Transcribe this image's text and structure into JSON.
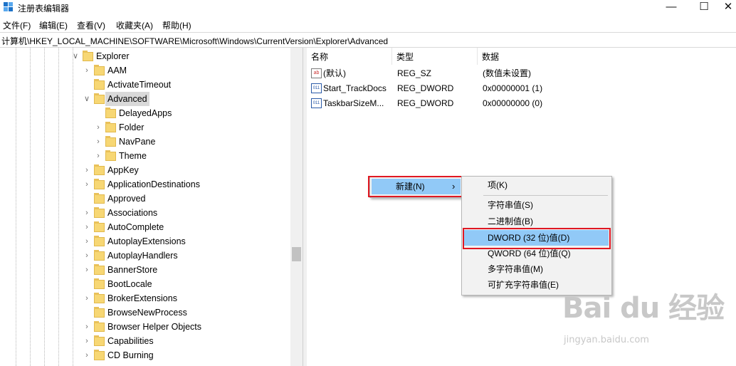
{
  "window": {
    "title": "注册表编辑器",
    "controls": {
      "minimize": "—",
      "maximize": "☐",
      "close": "✕"
    }
  },
  "menu": [
    "文件(F)",
    "编辑(E)",
    "查看(V)",
    "收藏夹(A)",
    "帮助(H)"
  ],
  "address": "计算机\\HKEY_LOCAL_MACHINE\\SOFTWARE\\Microsoft\\Windows\\CurrentVersion\\Explorer\\Advanced",
  "tree": {
    "items": [
      {
        "label": "Explorer",
        "chevron": "∨"
      },
      {
        "label": "AAM",
        "chevron": "›"
      },
      {
        "label": "ActivateTimeout",
        "chevron": ""
      },
      {
        "label": "Advanced",
        "chevron": "∨"
      },
      {
        "label": "DelayedApps",
        "chevron": ""
      },
      {
        "label": "Folder",
        "chevron": "›"
      },
      {
        "label": "NavPane",
        "chevron": "›"
      },
      {
        "label": "Theme",
        "chevron": "›"
      },
      {
        "label": "AppKey",
        "chevron": "›"
      },
      {
        "label": "ApplicationDestinations",
        "chevron": "›"
      },
      {
        "label": "Approved",
        "chevron": ""
      },
      {
        "label": "Associations",
        "chevron": "›"
      },
      {
        "label": "AutoComplete",
        "chevron": "›"
      },
      {
        "label": "AutoplayExtensions",
        "chevron": "›"
      },
      {
        "label": "AutoplayHandlers",
        "chevron": "›"
      },
      {
        "label": "BannerStore",
        "chevron": "›"
      },
      {
        "label": "BootLocale",
        "chevron": ""
      },
      {
        "label": "BrokerExtensions",
        "chevron": "›"
      },
      {
        "label": "BrowseNewProcess",
        "chevron": ""
      },
      {
        "label": "Browser Helper Objects",
        "chevron": "›"
      },
      {
        "label": "Capabilities",
        "chevron": "›"
      },
      {
        "label": "CD Burning",
        "chevron": "›"
      }
    ]
  },
  "list": {
    "headers": {
      "name": "名称",
      "type": "类型",
      "data": "数据"
    },
    "rows": [
      {
        "icon": "ab",
        "name": "(默认)",
        "type": "REG_SZ",
        "data": "(数值未设置)"
      },
      {
        "icon": "011",
        "name": "Start_TrackDocs",
        "type": "REG_DWORD",
        "data": "0x00000001 (1)"
      },
      {
        "icon": "011",
        "name": "TaskbarSizeM...",
        "type": "REG_DWORD",
        "data": "0x00000000 (0)"
      }
    ]
  },
  "context_menu": {
    "parent": {
      "label": "新建(N)",
      "arrow": "›"
    },
    "submenu": {
      "key": "项(K)",
      "items": [
        "字符串值(S)",
        "二进制值(B)",
        "DWORD (32 位)值(D)",
        "QWORD (64 位)值(Q)",
        "多字符串值(M)",
        "可扩充字符串值(E)"
      ]
    }
  },
  "watermark": {
    "brand": "Bai du 经验",
    "url": "jingyan.baidu.com"
  },
  "colors": {
    "highlight": "#91c9f7",
    "annotation_red": "#e01822",
    "selected_tree": "#d9d9d9"
  }
}
